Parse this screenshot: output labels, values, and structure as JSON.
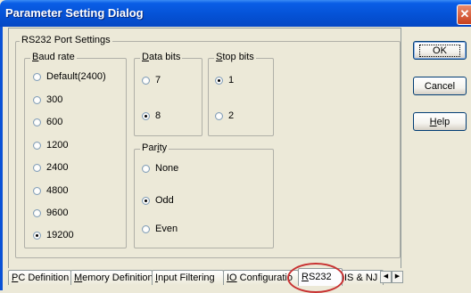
{
  "window": {
    "title": "Parameter Setting Dialog",
    "close_glyph": "✕"
  },
  "rs232_group": {
    "label": "RS232 Port Settings"
  },
  "baud_rate": {
    "label_prefix": "B",
    "label_rest": "aud rate",
    "options": [
      "Default(2400)",
      "300",
      "600",
      "1200",
      "2400",
      "4800",
      "9600",
      "19200"
    ],
    "selected": "19200"
  },
  "data_bits": {
    "label_prefix": "D",
    "label_rest": "ata bits",
    "options": [
      "7",
      "8"
    ],
    "selected": "8"
  },
  "stop_bits": {
    "label_prefix": "S",
    "label_rest": "top bits",
    "options": [
      "1",
      "2"
    ],
    "selected": "1"
  },
  "parity": {
    "label_pre": "Par",
    "label_u": "i",
    "label_post": "ty",
    "options": [
      "None",
      "Odd",
      "Even"
    ],
    "selected": "Odd"
  },
  "buttons": {
    "ok": "OK",
    "cancel": "Cancel",
    "help_prefix": "H",
    "help_rest": "elp"
  },
  "tabs": [
    {
      "u": "P",
      "rest": "C Definition"
    },
    {
      "u": "M",
      "rest": "emory Definition"
    },
    {
      "u": "I",
      "rest": "nput Filtering"
    },
    {
      "u": "IO",
      "rest": " Configuratio"
    },
    {
      "u": "R",
      "rest": "S232"
    },
    {
      "u": "",
      "rest": "IS & NJ"
    }
  ],
  "active_tab": "RS232",
  "tab_scroll": {
    "left": "◀",
    "right": "▶"
  }
}
